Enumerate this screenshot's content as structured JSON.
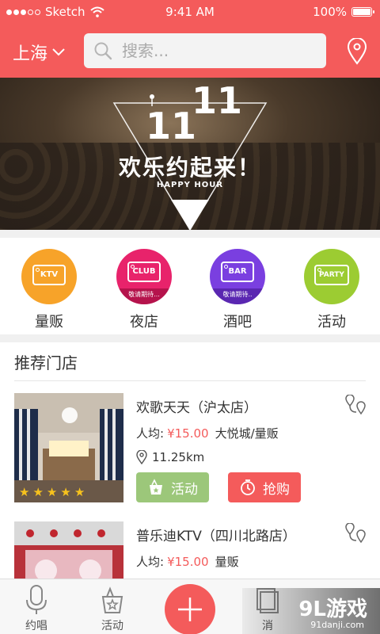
{
  "status": {
    "carrier": "Sketch",
    "time": "9:41 AM",
    "battery": "100%",
    "battery_level": 1.0
  },
  "header": {
    "city": "上海",
    "search_placeholder": "搜索..."
  },
  "banner": {
    "num_a": "11",
    "num_b": "11",
    "title": "欢乐约起来！",
    "sub": "HAPPY HOUR"
  },
  "categories": [
    {
      "label": "量贩",
      "card": "KTV",
      "color": "#f7a329",
      "sub": ""
    },
    {
      "label": "夜店",
      "card": "CLUB",
      "color": "#e8236b",
      "sub": "敬请期待..."
    },
    {
      "label": "酒吧",
      "card": "BAR",
      "color": "#7a3fe0",
      "sub": "敬请期待.."
    },
    {
      "label": "活动",
      "card": "PARTY",
      "color": "#9ccc32",
      "sub": ""
    }
  ],
  "recommend": {
    "title": "推荐门店",
    "stores": [
      {
        "name": "欢歌天天（沪太店）",
        "price_label": "人均:",
        "price": "¥15.00",
        "area": "大悦城/量贩",
        "distance": "11.25km",
        "activity": "活动",
        "buy": "抢购",
        "rating": 5
      },
      {
        "name": "普乐迪KTV（四川北路店）",
        "price_label": "人均:",
        "price": "¥15.00",
        "area": "量贩",
        "distance": "",
        "activity": "",
        "buy": "",
        "rating": 0
      }
    ]
  },
  "tabs": [
    {
      "label": "约唱"
    },
    {
      "label": "活动"
    },
    {
      "label": ""
    },
    {
      "label": "消"
    }
  ],
  "watermark": {
    "brand": "9L游戏",
    "url": "91danji.com"
  }
}
